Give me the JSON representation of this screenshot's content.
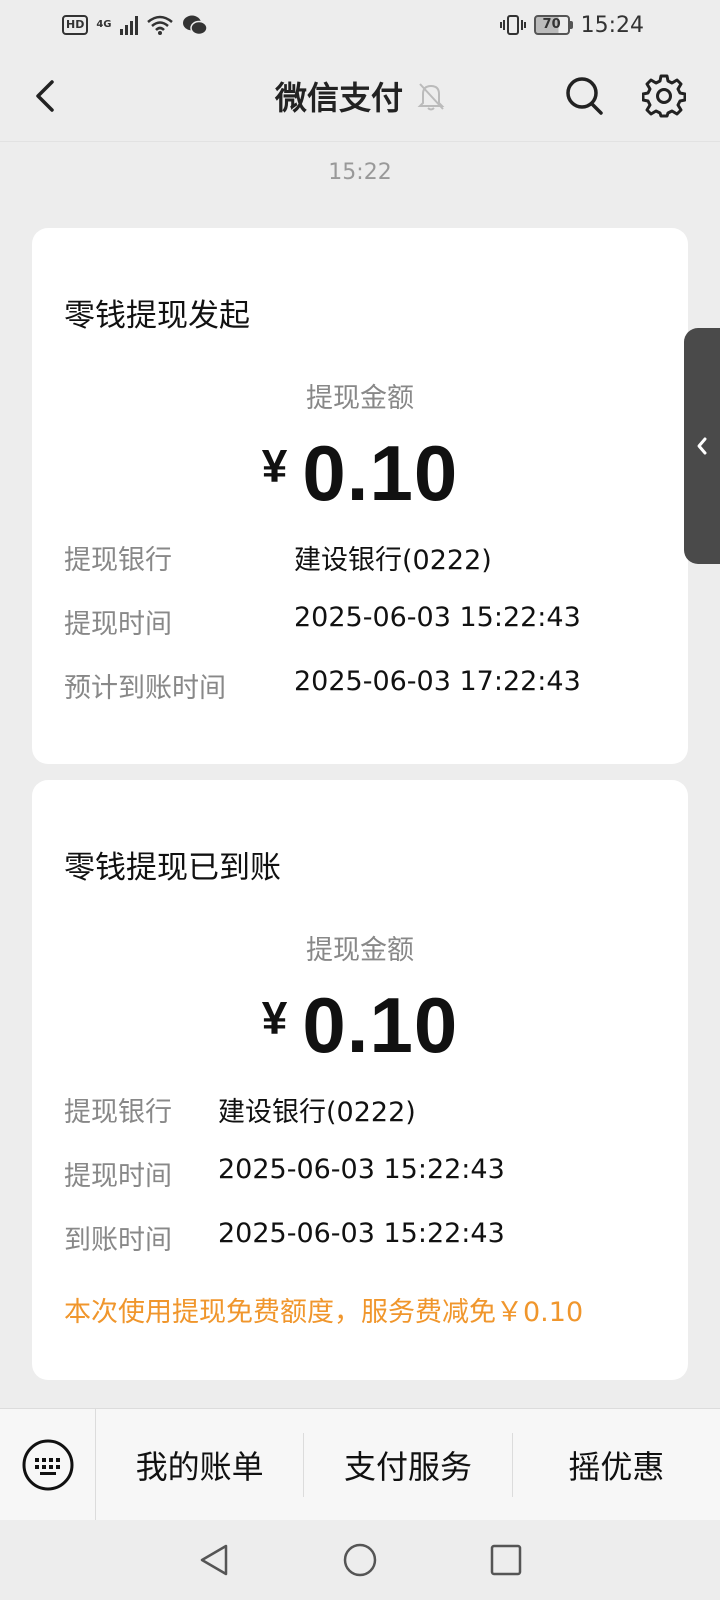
{
  "status_bar": {
    "hd": "HD",
    "network": "4G",
    "battery": "70",
    "time": "15:24"
  },
  "header": {
    "title": "微信支付"
  },
  "timestamp": "15:22",
  "cards": [
    {
      "title": "零钱提现发起",
      "amount_label": "提现金额",
      "currency": "¥",
      "amount": "0.10",
      "rows": [
        {
          "key": "提现银行",
          "value": "建设银行(0222)"
        },
        {
          "key": "提现时间",
          "value": "2025-06-03 15:22:43"
        },
        {
          "key": "预计到账时间",
          "value": "2025-06-03 17:22:43"
        }
      ]
    },
    {
      "title": "零钱提现已到账",
      "amount_label": "提现金额",
      "currency": "¥",
      "amount": "0.10",
      "rows": [
        {
          "key": "提现银行",
          "value": "建设银行(0222)"
        },
        {
          "key": "提现时间",
          "value": "2025-06-03 15:22:43"
        },
        {
          "key": "到账时间",
          "value": "2025-06-03 15:22:43"
        }
      ],
      "notice": "本次使用提现免费额度，服务费减免￥0.10"
    }
  ],
  "bottom_menu": {
    "items": [
      "我的账单",
      "支付服务",
      "摇优惠"
    ]
  },
  "colors": {
    "background": "#ededed",
    "card": "#ffffff",
    "notice": "#f0962c",
    "muted": "#888888"
  },
  "icons": {
    "back": "chevron-left-icon",
    "mute": "bell-off-icon",
    "search": "search-icon",
    "settings": "gear-icon",
    "side_handle": "chevron-left-icon",
    "keyboard": "keyboard-icon"
  }
}
